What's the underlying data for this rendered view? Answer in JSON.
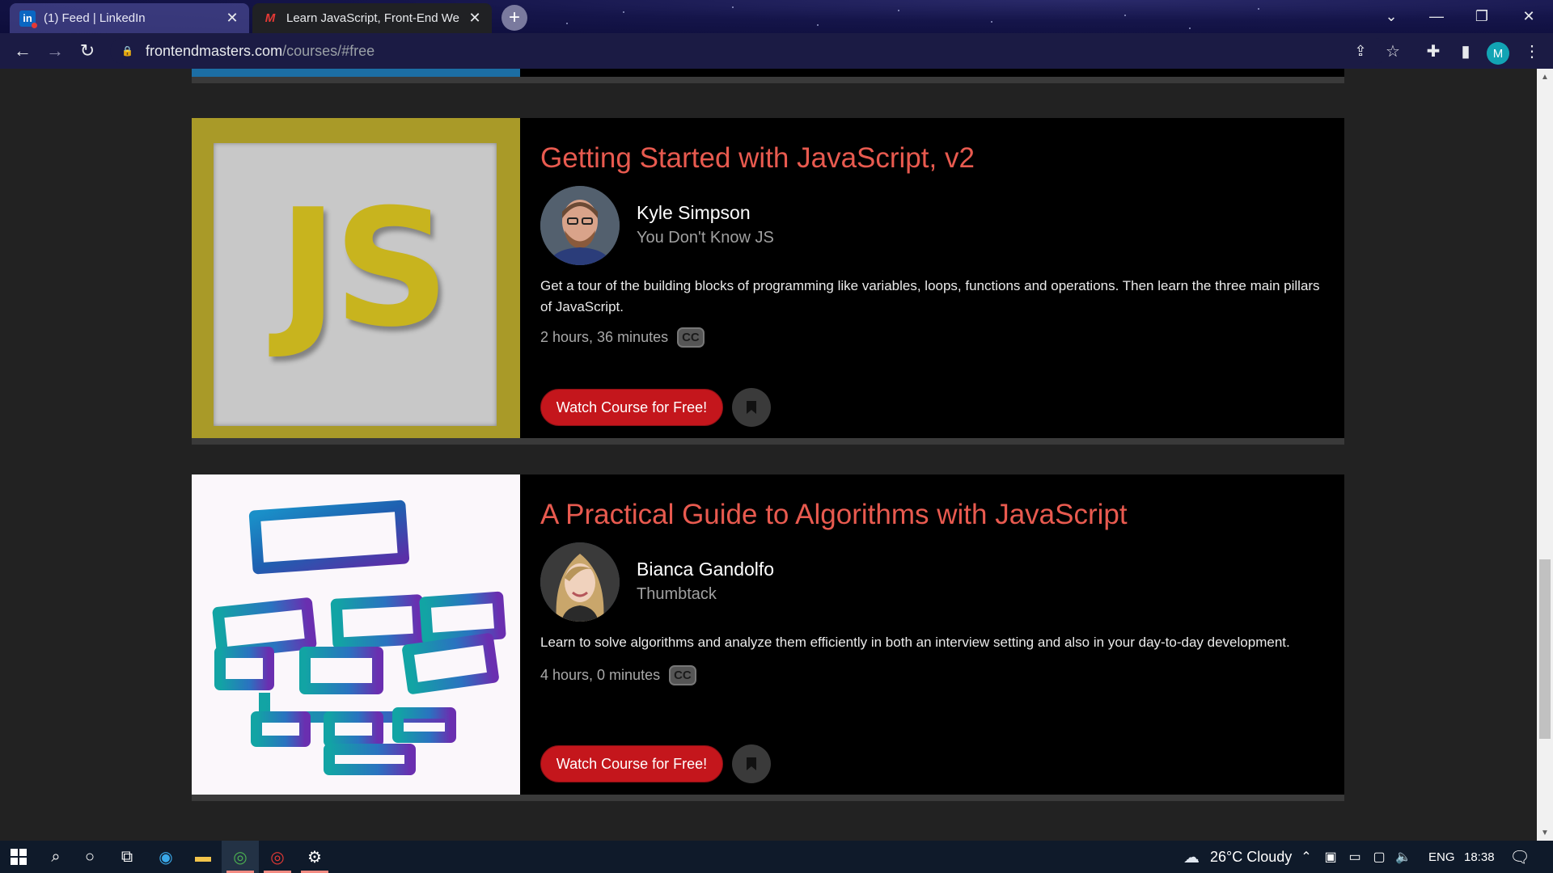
{
  "browser": {
    "tabs": [
      {
        "title": "(1) Feed | LinkedIn",
        "favicon": "linkedin-icon",
        "active": false
      },
      {
        "title": "Learn JavaScript, Front-End Web",
        "favicon": "frontendmasters-icon",
        "active": true
      }
    ],
    "url_host": "frontendmasters.com",
    "url_path": "/courses/#free",
    "profile_initial": "M"
  },
  "courses": [
    {
      "title": "Getting Started with JavaScript, v2",
      "author": "Kyle Simpson",
      "org": "You Don't Know JS",
      "description": "Get a tour of the building blocks of programming like variables, loops, functions and operations. Then learn the three main pillars of JavaScript.",
      "duration": "2 hours, 36 minutes",
      "cc": "CC",
      "watch_label": "Watch Course for Free!",
      "thumb_text": "JS"
    },
    {
      "title": "A Practical Guide to Algorithms with JavaScript",
      "author": "Bianca Gandolfo",
      "org": "Thumbtack",
      "description": "Learn to solve algorithms and analyze them efficiently in both an interview setting and also in your day-to-day development.",
      "duration": "4 hours, 0 minutes",
      "cc": "CC",
      "watch_label": "Watch Course for Free!"
    }
  ],
  "taskbar": {
    "weather": "26°C  Cloudy",
    "language": "ENG",
    "time": "18:38"
  },
  "colors": {
    "accent_title": "#e85a4f",
    "button_red": "#c4161c",
    "card_bg": "#000000",
    "page_bg": "#222222"
  }
}
